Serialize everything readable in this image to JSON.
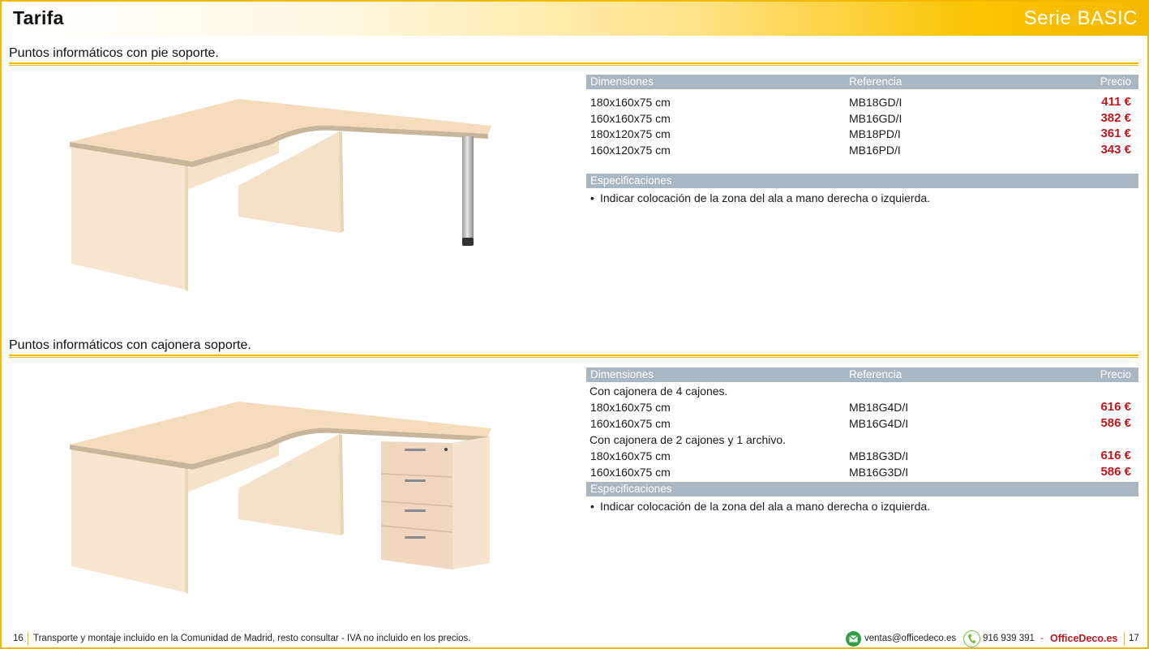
{
  "header": {
    "title": "Tarifa",
    "series": "Serie BASIC"
  },
  "sections": [
    {
      "title": "Puntos informáticos con pie soporte.",
      "image": "l-shaped-desk-with-metal-leg",
      "table": {
        "headers": {
          "dimensions": "Dimensiones",
          "reference": "Referencia",
          "price": "Precio"
        },
        "rows": [
          {
            "dimensions": "180x160x75 cm",
            "reference": "MB18GD/I",
            "price": "411 €"
          },
          {
            "dimensions": "160x160x75 cm",
            "reference": "MB16GD/I",
            "price": "382 €"
          },
          {
            "dimensions": "180x120x75 cm",
            "reference": "MB18PD/I",
            "price": "361 €"
          },
          {
            "dimensions": "160x120x75 cm",
            "reference": "MB16PD/I",
            "price": "343 €"
          }
        ]
      },
      "specs": {
        "header": "Especificaciones",
        "bullet": "•",
        "items": [
          "Indicar colocación de la zona del ala a mano derecha o izquierda."
        ]
      }
    },
    {
      "title": "Puntos informáticos con cajonera soporte.",
      "image": "l-shaped-desk-with-drawer-pedestal",
      "table": {
        "headers": {
          "dimensions": "Dimensiones",
          "reference": "Referencia",
          "price": "Precio"
        },
        "groups": [
          {
            "label": "Con cajonera de 4 cajones.",
            "rows": [
              {
                "dimensions": "180x160x75 cm",
                "reference": "MB18G4D/I",
                "price": "616 €"
              },
              {
                "dimensions": "160x160x75 cm",
                "reference": "MB16G4D/I",
                "price": "586 €"
              }
            ]
          },
          {
            "label": "Con cajonera de 2 cajones y 1 archivo.",
            "rows": [
              {
                "dimensions": "180x160x75 cm",
                "reference": "MB18G3D/I",
                "price": "616 €"
              },
              {
                "dimensions": "160x160x75 cm",
                "reference": "MB16G3D/I",
                "price": "586 €"
              }
            ]
          }
        ]
      },
      "specs": {
        "header": "Especificaciones",
        "bullet": "•",
        "items": [
          "Indicar colocación de la zona del ala a mano derecha o izquierda."
        ]
      }
    }
  ],
  "footer": {
    "page_left": "16",
    "note": "Transporte y montaje incluido en la Comunidad de Madrid, resto consultar - IVA no incluido en los precios.",
    "email": "ventas@officedeco.es",
    "phone": "916 939 391",
    "dash": "-",
    "brand": "OfficeDeco.es",
    "page_right": "17"
  },
  "colors": {
    "accent": "#f5b800",
    "table_header": "#a9b7c3",
    "price": "#c0171c",
    "wood": "#f3dfc4"
  }
}
